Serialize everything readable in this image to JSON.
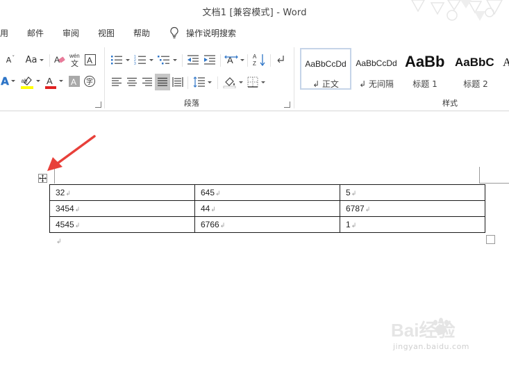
{
  "window": {
    "title": "文档1 [兼容模式]  -  Word"
  },
  "menu": {
    "tabs": [
      "用",
      "邮件",
      "审阅",
      "视图",
      "帮助"
    ],
    "tell_me": "操作说明搜索"
  },
  "ribbon": {
    "font_group": {
      "change_case_label": "Aa",
      "wen_label": "wén",
      "wen_char": "文",
      "enclose_char": "字",
      "clear_format_label": "A",
      "border_char_label": "A",
      "shade_char_label": "A",
      "grow_label": "A",
      "text_effect_label": "A",
      "highlight_color": "#ffff00",
      "font_color": "#e02020"
    },
    "paragraph_group": {
      "label": "段落"
    },
    "styles_group": {
      "label": "样式",
      "styles": [
        {
          "sample": "AaBbCcDd",
          "name": "↲ 正文"
        },
        {
          "sample": "AaBbCcDd",
          "name": "↲ 无间隔"
        },
        {
          "sample": "AaBb",
          "name": "标题 1"
        },
        {
          "sample": "AaBbC",
          "name": "标题 2"
        },
        {
          "sample": "A",
          "name": ""
        }
      ]
    }
  },
  "document": {
    "table": {
      "rows": [
        [
          "32",
          "645",
          "5"
        ],
        [
          "3454",
          "44",
          "6787"
        ],
        [
          "4545",
          "6766",
          "1"
        ]
      ]
    },
    "paragraph_mark": "↲",
    "arrow_color": "#e8403a"
  },
  "watermark": {
    "brand": "Bai经验",
    "url": "jingyan.baidu.com"
  }
}
